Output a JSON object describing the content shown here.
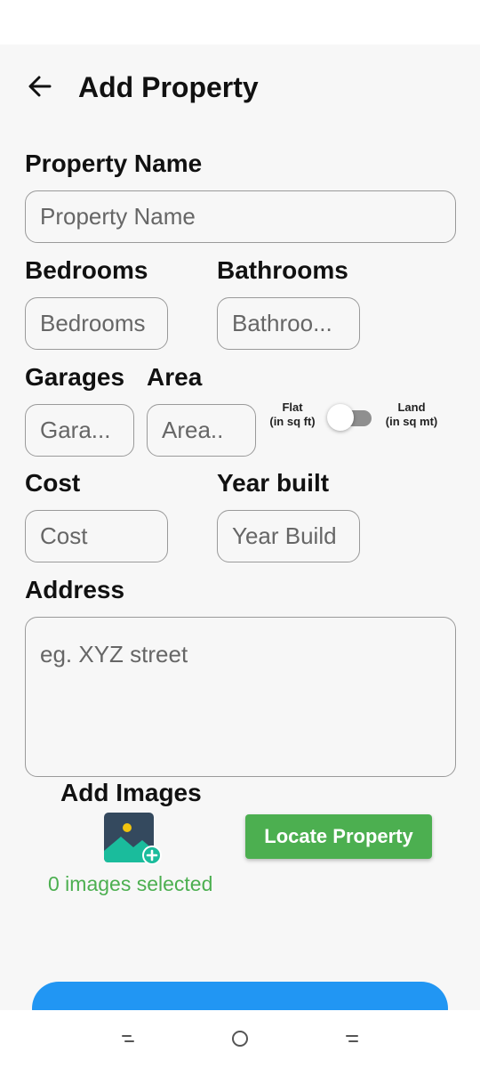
{
  "header": {
    "back_icon": "arrow-left-icon",
    "title": "Add Property"
  },
  "form": {
    "property_name": {
      "label": "Property Name",
      "placeholder": "Property Name"
    },
    "bedrooms": {
      "label": "Bedrooms",
      "placeholder": "Bedrooms"
    },
    "bathrooms": {
      "label": "Bathrooms",
      "placeholder": "Bathroo..."
    },
    "garages": {
      "label": "Garages",
      "placeholder": "Gara..."
    },
    "area": {
      "label": "Area",
      "placeholder": "Area.."
    },
    "area_unit_toggle": {
      "left_label_line1": "Flat",
      "left_label_line2": "(in sq ft)",
      "right_label_line1": "Land",
      "right_label_line2": "(in sq mt)",
      "selected": "Flat"
    },
    "cost": {
      "label": "Cost",
      "placeholder": "Cost"
    },
    "year_built": {
      "label": "Year built",
      "placeholder": "Year Build"
    },
    "address": {
      "label": "Address",
      "placeholder": "eg. XYZ street"
    }
  },
  "images": {
    "label": "Add Images",
    "icon": "add-image-icon",
    "count_text": "0 images selected"
  },
  "locate_button": {
    "label": "Locate Property"
  },
  "nav": {
    "recents_icon": "recent-apps-icon",
    "home_icon": "home-circle-icon",
    "back_icon": "nav-back-icon"
  },
  "colors": {
    "accent_green": "#4caf50",
    "accent_blue": "#2196f3",
    "background": "#f7f7f7",
    "field_border": "#9a9a9a"
  }
}
